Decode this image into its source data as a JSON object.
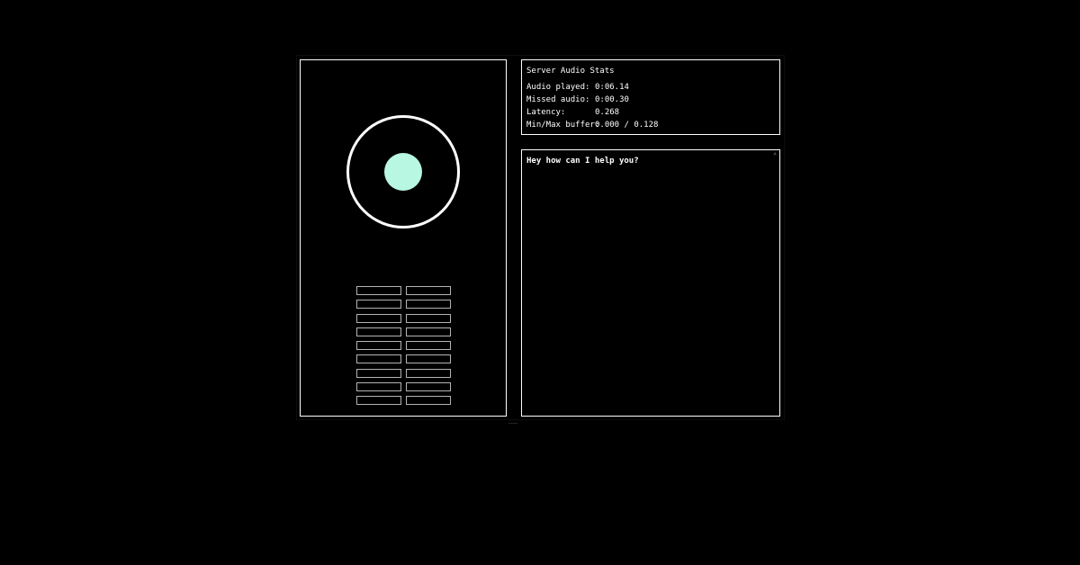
{
  "colors": {
    "background": "#000000",
    "border": "#ffffff",
    "orb_core": "#b8f7e2",
    "meter_border": "#b3b3b3",
    "text": "#ffffff"
  },
  "orb": {
    "core_icon": "audio-orb-icon"
  },
  "meters": {
    "rows": 9,
    "columns": 2,
    "levels": [
      0,
      0,
      0,
      0,
      0,
      0,
      0,
      0,
      0,
      0,
      0,
      0,
      0,
      0,
      0,
      0,
      0,
      0
    ]
  },
  "stats": {
    "title": "Server Audio Stats",
    "rows": [
      {
        "label": "Audio played:",
        "value": "0:06.14"
      },
      {
        "label": "Missed audio:",
        "value": "0:00.30"
      },
      {
        "label": "Latency:",
        "value": "0.268"
      },
      {
        "label": "Min/Max buffer:",
        "value": "0.000 / 0.128"
      }
    ]
  },
  "chat": {
    "message": "Hey how can I help you?",
    "scroll_icon": "scroll-up-icon"
  }
}
